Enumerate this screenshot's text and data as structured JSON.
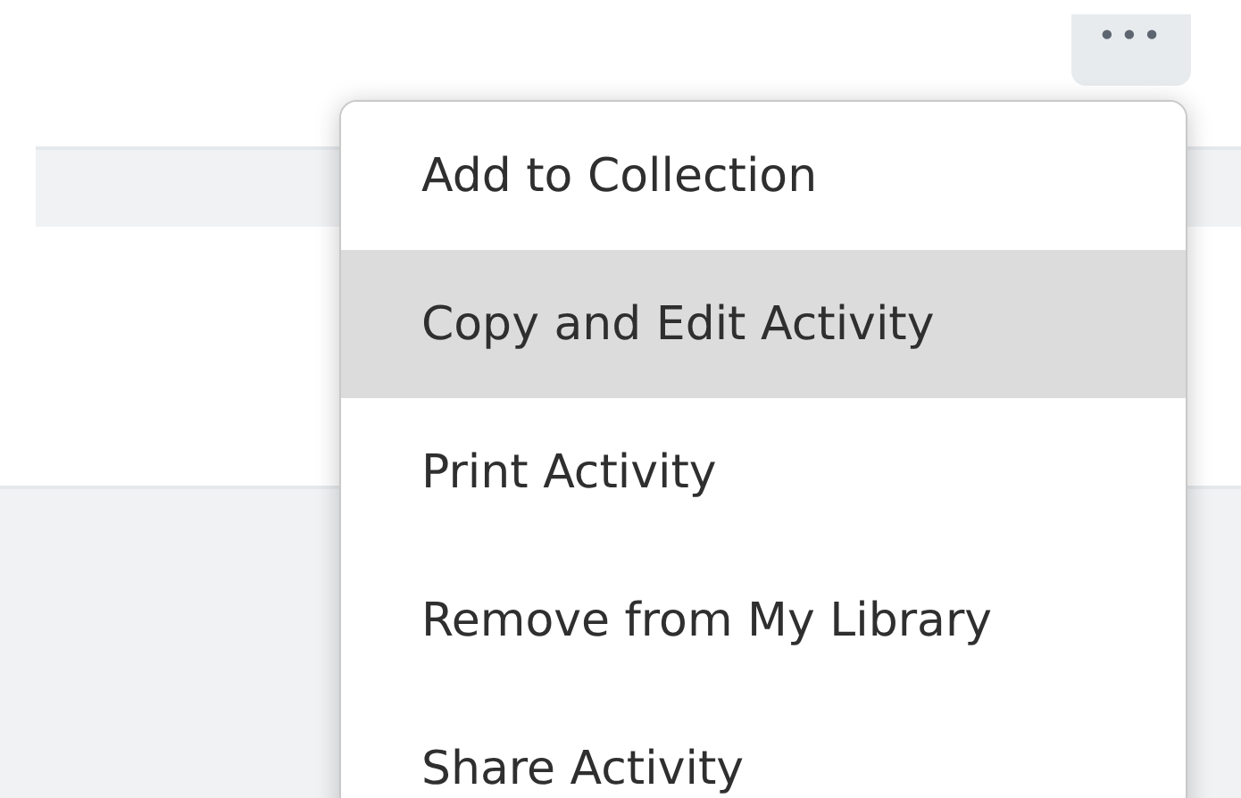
{
  "more_button": {
    "label": "•••"
  },
  "menu": {
    "items": [
      {
        "label": "Add to Collection",
        "selected": false
      },
      {
        "label": "Copy and Edit Activity",
        "selected": true
      },
      {
        "label": "Print Activity",
        "selected": false
      },
      {
        "label": "Remove from My Library",
        "selected": false
      },
      {
        "label": "Share Activity",
        "selected": false
      }
    ]
  }
}
